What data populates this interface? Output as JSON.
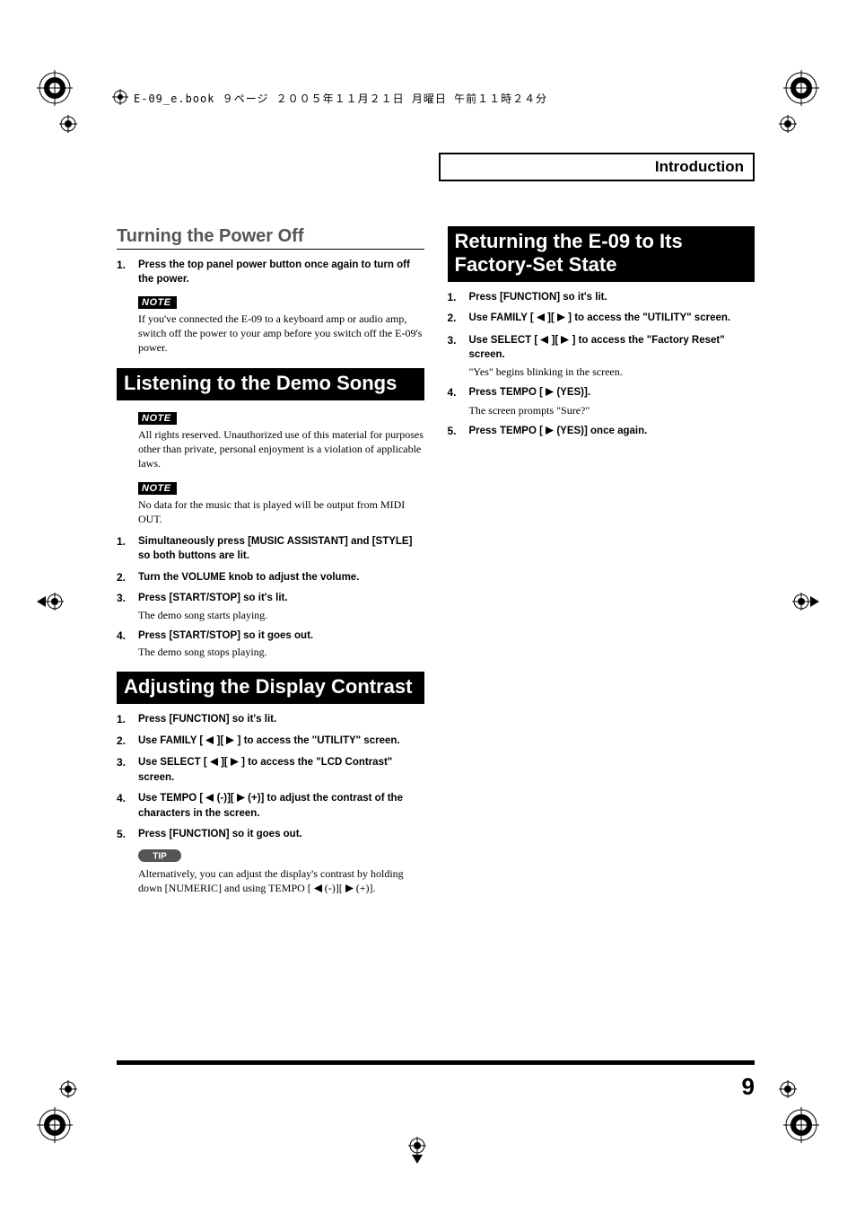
{
  "header_tag": "E-09_e.book ９ページ ２００５年１１月２１日 月曜日 午前１１時２４分",
  "intro_title": "Introduction",
  "page_number": "9",
  "left": {
    "h_power_off": "Turning the Power Off",
    "power_off_step1_num": "1.",
    "power_off_step1": "Press the top panel power button once again to turn off the power.",
    "note_label_1": "NOTE",
    "power_off_note": "If you've connected the E-09 to a keyboard amp or audio amp, switch off the power to your amp before you switch off the E-09's power.",
    "h_demo": "Listening to the Demo Songs",
    "note_label_2": "NOTE",
    "demo_note1": "All rights reserved. Unauthorized use of this material for purposes other than private, personal enjoyment is a violation of applicable laws.",
    "note_label_3": "NOTE",
    "demo_note2": "No data for the music that is played will be output from MIDI OUT.",
    "demo_s1_num": "1.",
    "demo_s1": "Simultaneously press [MUSIC ASSISTANT] and [STYLE] so both buttons are lit.",
    "demo_s2_num": "2.",
    "demo_s2": "Turn the VOLUME knob to adjust the volume.",
    "demo_s3_num": "3.",
    "demo_s3": "Press [START/STOP] so it's lit.",
    "demo_s3_body": "The demo song starts playing.",
    "demo_s4_num": "4.",
    "demo_s4": "Press [START/STOP] so it goes out.",
    "demo_s4_body": "The demo song stops playing.",
    "h_contrast": "Adjusting the Display Contrast",
    "c_s1_num": "1.",
    "c_s1": "Press [FUNCTION] so it's lit.",
    "c_s2_num": "2.",
    "c_s2_a": "Use FAMILY [ ",
    "c_s2_b": " ][ ",
    "c_s2_c": " ] to access the \"UTILITY\" screen.",
    "c_s3_num": "3.",
    "c_s3_a": "Use SELECT [ ",
    "c_s3_b": " ][ ",
    "c_s3_c": " ] to access the \"LCD Contrast\" screen.",
    "c_s4_num": "4.",
    "c_s4_a": "Use TEMPO [ ",
    "c_s4_b": " (-)][ ",
    "c_s4_c": " (+)] to adjust the contrast of the characters in the screen.",
    "c_s5_num": "5.",
    "c_s5": "Press [FUNCTION] so it goes out.",
    "tip_label": "TIP",
    "c_tip_a": "Alternatively, you can adjust the display's contrast by holding down [NUMERIC] and using TEMPO [ ",
    "c_tip_b": " (-)][ ",
    "c_tip_c": " (+)]."
  },
  "right": {
    "h_reset": "Returning the E-09 to Its Factory-Set State",
    "r_s1_num": "1.",
    "r_s1": "Press [FUNCTION] so it's lit.",
    "r_s2_num": "2.",
    "r_s2_a": "Use FAMILY [ ",
    "r_s2_b": " ][ ",
    "r_s2_c": " ] to access the \"UTILITY\" screen.",
    "r_s3_num": "3.",
    "r_s3_a": "Use SELECT [ ",
    "r_s3_b": " ][ ",
    "r_s3_c": " ] to access the \"Factory Reset\" screen.",
    "r_s3_body": "\"Yes\" begins blinking in the screen.",
    "r_s4_num": "4.",
    "r_s4_a": "Press TEMPO [ ",
    "r_s4_b": " (YES)].",
    "r_s4_body": "The screen prompts \"Sure?\"",
    "r_s5_num": "5.",
    "r_s5_a": "Press TEMPO [ ",
    "r_s5_b": " (YES)] once again."
  }
}
